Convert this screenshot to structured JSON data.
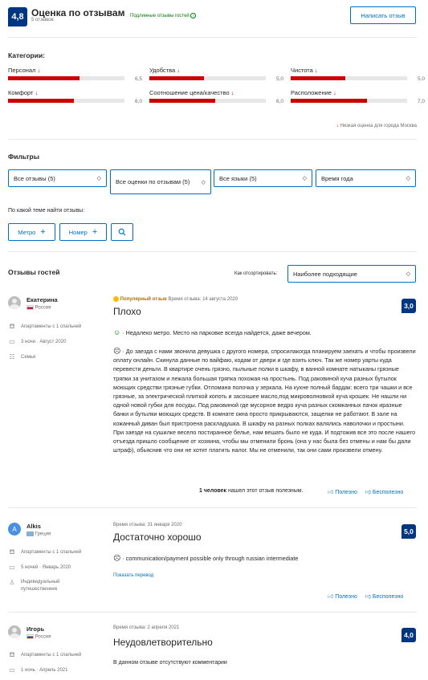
{
  "header": {
    "score": "4,8",
    "title": "Оценка по отзывам",
    "count": "5 отзывов",
    "verified": "Подлинные отзывы гостей",
    "write_button": "Написать отзыв"
  },
  "categories": {
    "heading": "Категории:",
    "items": [
      {
        "label": "Персонал",
        "value": "6,5",
        "score": 6.5
      },
      {
        "label": "Удобства",
        "value": "5,0",
        "score": 5.0
      },
      {
        "label": "Чистота",
        "value": "5,0",
        "score": 5.0
      },
      {
        "label": "Комфорт",
        "value": "6,0",
        "score": 6.0
      },
      {
        "label": "Соотношение цена/качество",
        "value": "6,0",
        "score": 6.0
      },
      {
        "label": "Расположение",
        "value": "7,0",
        "score": 7.0
      }
    ],
    "low_score_note": "Низкая оценка для города Москва"
  },
  "filters": {
    "heading": "Фильтры",
    "dropdowns": [
      "Все отзывы (5)",
      "Все оценки по отзывам (5)",
      "Все языки (5)",
      "Время года"
    ],
    "topic_label": "По какой теме найти отзывы:",
    "chips": [
      "Метро",
      "Номер"
    ]
  },
  "reviews_section": {
    "heading": "Отзывы гостей",
    "sort_label": "Как отсортировать:",
    "sort_value": "Наиболее подходящие"
  },
  "reviews": [
    {
      "name": "Екатерина",
      "country": "Россия",
      "room": "Апартаменты с 1 спальней",
      "stay": "3 ночи · Август 2020",
      "traveler": "Семья",
      "popular": "Популярный отзыв",
      "date": "Время отзыва: 14 августа 2020",
      "title": "Плохо",
      "score": "3,0",
      "positive": "· Недалеко метро. Место на парковке всегда найдется, даже вечером.",
      "negative": "· До заезда с нами звонила девушка с другого номера, спросилакогда планируем заехать и чтобы произвели оплату онлайн. Скинула данные по вайфаю, кодам от двери и где взять ключ. Так же номер уарты куда перевести деньги. В квартире очень грязно, пыльные полки в шкафу, в ванной комнате натыканы грязные тряпки за унитазом и лежала большая тряпка похожая на простынь. Под раковиной куча разных бутылок моющих средстви грязные губки. Отломана полочка у зеркала. На кухне полный бардак: всего три чашки и все грязные, за электрической плиткой копоть и засохшее масло,под микроволновкой куча крошек. Не нашли ни одной новой губки для посуды. Под раковиной где мусорное ведро куча разных скомканных пачок иразные банки и бутылки моющих средств. В комнате окна просто прикрываются, защелки не работают. В зале на кожанный диван был пристроена раскладушка. В шкафу на разных полках валялись наволочки и простыни. При заезде на сушилке весело постиранное белье, нам вешать было не куда. И подтожив все это после нашего отъезда пришло сообщение от хозяина, чтобы мы отменили бронь (она у нас была без отмены и нам бы дали штраф), обьяснив что они не хотят платить налог. Мы не отменили, так они сами произвели отмену.",
      "helpful_count": "1 человек",
      "helpful_text": "нашел этот отзыв полезным.",
      "helpful": "Полезно",
      "unhelpful": "Бесполезно"
    },
    {
      "name": "Alkis",
      "initial": "A",
      "country": "Греция",
      "room": "Апартаменты с 1 спальней",
      "stay": "5 ночей · Январь 2020",
      "traveler": "Индивидуальный путешественник",
      "date": "Время отзыва: 31 января 2020",
      "title": "Достаточно хорошо",
      "score": "5,0",
      "negative": "· communication/payment possible only through russian intermediate",
      "translate": "Показать перевод",
      "helpful": "Полезно",
      "unhelpful": "Бесполезно"
    },
    {
      "name": "Игорь",
      "country": "Россия",
      "room": "Апартаменты с 1 спальней",
      "stay": "1 ночь · Апрель 2021",
      "date": "Время отзыва: 2 апреля 2021",
      "title": "Неудовлетворительно",
      "score": "4,0",
      "no_comments": "В данном отзыве отсутствуют комментарии"
    }
  ],
  "colors": {
    "brand": "#003580",
    "link": "#0071c2",
    "low": "#cc0000",
    "verified": "#008009",
    "popular": "#febb02"
  }
}
